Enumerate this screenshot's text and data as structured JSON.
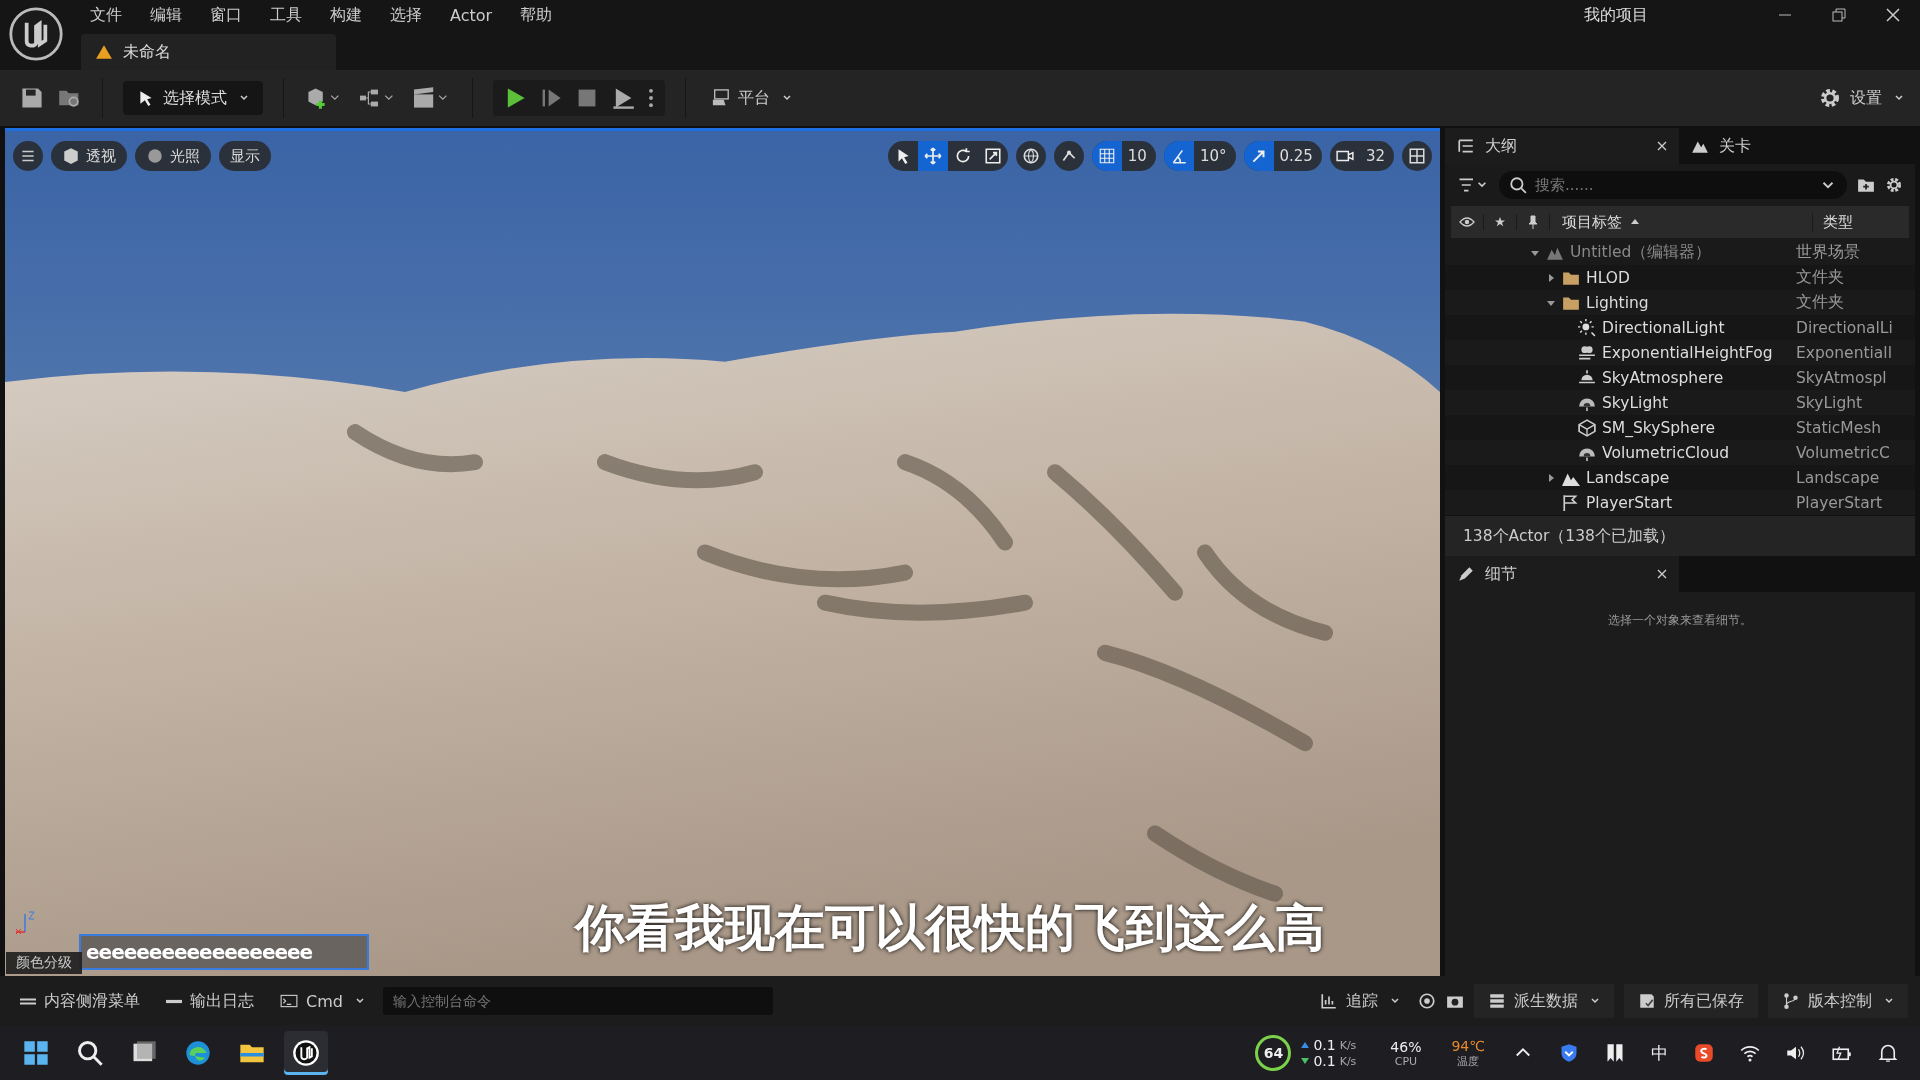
{
  "title_bar": {
    "project": "我的项目"
  },
  "menu": [
    "文件",
    "编辑",
    "窗口",
    "工具",
    "构建",
    "选择",
    "Actor",
    "帮助"
  ],
  "level_tab": {
    "label": "未命名"
  },
  "toolbar": {
    "mode": "选择模式",
    "platform": "平台",
    "settings": "设置"
  },
  "viewport": {
    "buttons": [
      {
        "kind": "menu"
      },
      {
        "kind": "perspective",
        "label": "透视"
      },
      {
        "kind": "lighting",
        "label": "光照"
      },
      {
        "kind": "show",
        "label": "显示"
      }
    ],
    "transform_tools": [
      {
        "kind": "select",
        "selected": false
      },
      {
        "kind": "move",
        "selected": true
      },
      {
        "kind": "rotate",
        "selected": false
      },
      {
        "kind": "scale",
        "selected": false
      }
    ],
    "snaps": [
      {
        "kind": "grid",
        "value": "10",
        "on": true
      },
      {
        "kind": "angle",
        "value": "10°",
        "on": true
      },
      {
        "kind": "scale",
        "value": "0.25",
        "on": true
      },
      {
        "kind": "camera",
        "value": "32",
        "on": false
      }
    ],
    "text_field": {
      "value": "eeeeeeeeeeeeeeeeee"
    }
  },
  "subtitle": "你看我现在可以很快的飞到这么高",
  "outliner": {
    "tabs": [
      {
        "label": "大纲",
        "selected": true
      },
      {
        "label": "关卡",
        "selected": false
      }
    ],
    "search": {
      "placeholder": "搜索......"
    },
    "columns": [
      "项目标签",
      "类型"
    ],
    "rows": [
      {
        "label": "Untitled（编辑器）",
        "type": "世界场景",
        "kind": "world",
        "expanded": true,
        "children": [
          {
            "label": "HLOD",
            "type": "文件夹",
            "kind": "folder",
            "expanded": false
          },
          {
            "label": "Lighting",
            "type": "文件夹",
            "kind": "folder",
            "expanded": true,
            "children": [
              {
                "label": "DirectionalLight",
                "type": "DirectionalLi",
                "kind": "sun"
              },
              {
                "label": "ExponentialHeightFog",
                "type": "Exponentiall",
                "kind": "fog"
              },
              {
                "label": "SkyAtmosphere",
                "type": "SkyAtmospl",
                "kind": "atmosphere"
              },
              {
                "label": "SkyLight",
                "type": "SkyLight",
                "kind": "dome"
              },
              {
                "label": "SM_SkySphere",
                "type": "StaticMesh",
                "kind": "mesh"
              },
              {
                "label": "VolumetricCloud",
                "type": "VolumetricC",
                "kind": "dome"
              }
            ]
          },
          {
            "label": "Landscape",
            "type": "Landscape",
            "kind": "mountain",
            "expanded": false
          },
          {
            "label": "PlayerStart",
            "type": "PlayerStart",
            "kind": "flag"
          }
        ]
      }
    ],
    "footer": "138个Actor（138个已加载）"
  },
  "details": {
    "tab": "细节",
    "empty_text": "选择一个对象来查看细节。"
  },
  "bottom_bar": {
    "floating_tab": "颜色分级",
    "tabs": [
      "内容侧滑菜单",
      "输出日志"
    ],
    "cmd": "Cmd",
    "console": {
      "placeholder": "输入控制台命令"
    },
    "trace": "追踪",
    "right": [
      {
        "kind": "data",
        "label": "派生数据"
      },
      {
        "kind": "save",
        "label": "所有已保存"
      },
      {
        "kind": "branch",
        "label": "版本控制"
      }
    ]
  },
  "taskbar": {
    "apps": [
      {
        "kind": "start",
        "selected": false
      },
      {
        "kind": "search",
        "selected": false
      },
      {
        "kind": "taskview",
        "selected": false
      },
      {
        "kind": "browser",
        "selected": false
      },
      {
        "kind": "folder",
        "selected": false
      },
      {
        "kind": "unreal",
        "selected": true
      }
    ],
    "badge": "64",
    "net": [
      {
        "reading": "0.1",
        "unit": "K/s"
      },
      {
        "reading": "0.1",
        "unit": "K/s"
      }
    ],
    "cpu": {
      "value": "46%",
      "label": "CPU"
    },
    "temp": {
      "value": "94℃",
      "label": "温度"
    },
    "ime": "中"
  }
}
